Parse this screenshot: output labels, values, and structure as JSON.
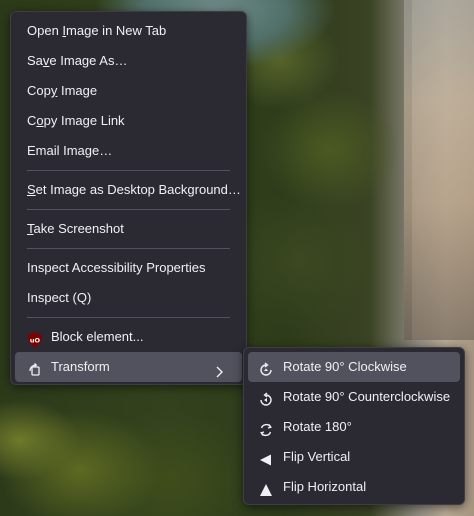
{
  "context_menu": {
    "items": [
      {
        "pre": "Open ",
        "key": "I",
        "post": "mage in New Tab"
      },
      {
        "pre": "Sa",
        "key": "v",
        "post": "e Image As…"
      },
      {
        "pre": "Cop",
        "key": "y",
        "post": " Image"
      },
      {
        "pre": "C",
        "key": "o",
        "post": "py Image Link"
      },
      {
        "pre": "Email Ima",
        "key": "g",
        "post": "e…"
      },
      {
        "pre": "",
        "key": "S",
        "post": "et Image as Desktop Background…"
      },
      {
        "pre": "",
        "key": "T",
        "post": "ake Screenshot"
      },
      {
        "label": "Inspect Accessibility Properties"
      },
      {
        "label": "Inspect (Q)"
      },
      {
        "label": "Block element..."
      },
      {
        "label": "Transform"
      }
    ]
  },
  "submenu": {
    "items": [
      {
        "label": "Rotate 90° Clockwise"
      },
      {
        "label": "Rotate 90° Counterclockwise"
      },
      {
        "label": "Rotate 180°"
      },
      {
        "label": "Flip Vertical"
      },
      {
        "label": "Flip Horizontal"
      }
    ]
  },
  "colors": {
    "menu_bg": "#2b2a33",
    "hover_bg": "#52525e",
    "text": "#f0f0f4",
    "ublock_red": "#800000"
  }
}
